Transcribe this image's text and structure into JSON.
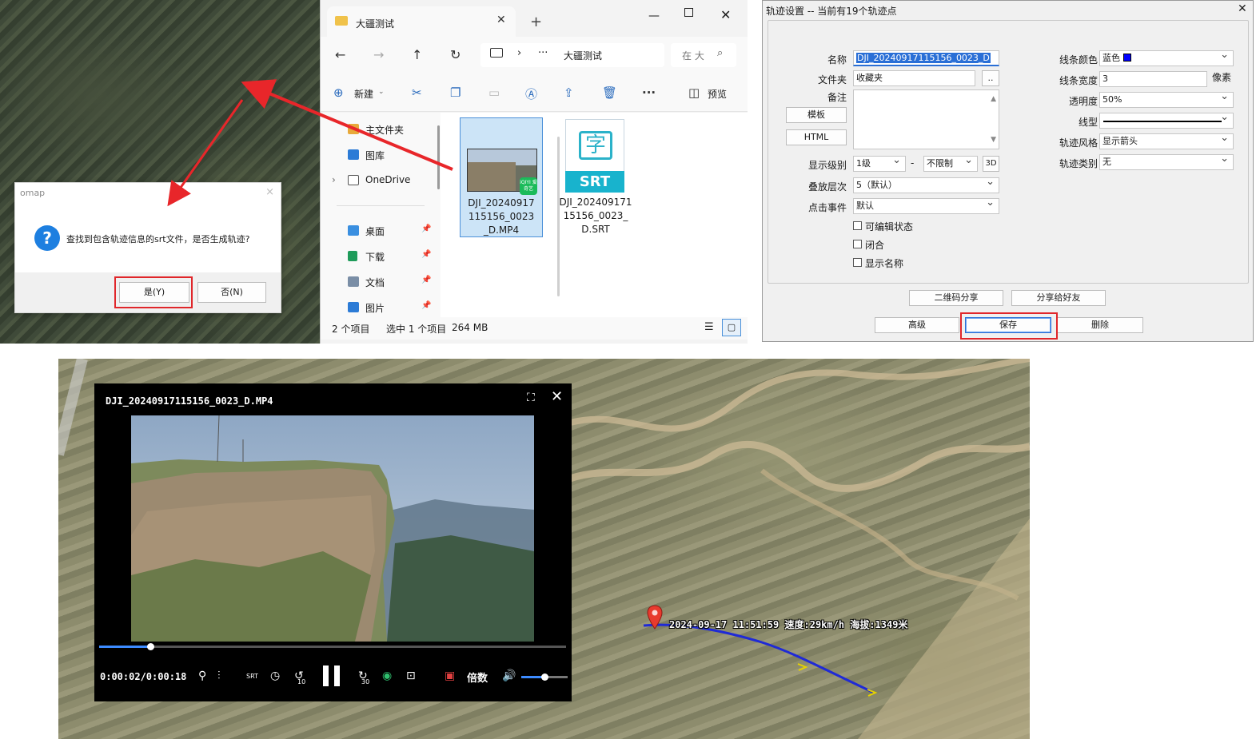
{
  "omap_dialog": {
    "title": "omap",
    "close": "×",
    "question_icon": "?",
    "message": "查找到包含轨迹信息的srt文件，是否生成轨迹?",
    "yes_label": "是(Y)",
    "no_label": "否(N)"
  },
  "explorer": {
    "tab_title": "大疆测试",
    "tab_close": "✕",
    "new_tab": "+",
    "address": {
      "chevron": "›",
      "dots": "···",
      "path": "大疆测试"
    },
    "search_placeholder": "在 大",
    "toolbar": {
      "new_label": "新建",
      "preview_label": "预览"
    },
    "sidebar": [
      {
        "label": "主文件夹",
        "icon": "home-icon",
        "pinned": false
      },
      {
        "label": "图库",
        "icon": "gallery-icon",
        "pinned": false
      },
      {
        "label": "OneDrive",
        "icon": "cloud-icon",
        "pinned": false
      },
      {
        "label": "桌面",
        "icon": "desktop-icon",
        "pinned": true
      },
      {
        "label": "下载",
        "icon": "download-icon",
        "pinned": true
      },
      {
        "label": "文档",
        "icon": "document-icon",
        "pinned": true
      },
      {
        "label": "图片",
        "icon": "pictures-icon",
        "pinned": true
      }
    ],
    "files": [
      {
        "name": "DJI_20240917115156_0023_D.MP4",
        "type": "video",
        "badge": "iQIYI 爱奇艺"
      },
      {
        "name": "DJI_20240917115156_0023_D.SRT",
        "type": "srt",
        "glyph": "字",
        "band": "SRT"
      }
    ],
    "status": {
      "count": "2 个项目",
      "selected": "选中 1 个项目",
      "size": "264 MB"
    }
  },
  "track_dialog": {
    "title": "轨迹设置 -- 当前有19个轨迹点",
    "close": "✕",
    "labels": {
      "name": "名称",
      "folder": "文件夹",
      "note": "备注",
      "display_level": "显示级别",
      "stack_level": "叠放层次",
      "click_event": "点击事件",
      "line_color": "线条颜色",
      "line_width": "线条宽度",
      "opacity": "透明度",
      "line_type": "线型",
      "track_style": "轨迹风格",
      "track_type": "轨迹类别",
      "pixels": "像素",
      "dash": "-"
    },
    "values": {
      "name": "DJI_20240917115156_0023_D",
      "folder": "收藏夹",
      "folder_browse": "..",
      "display_level_from": "1级",
      "display_level_to": "不限制",
      "btn_3d": "3D",
      "stack_level": "5（默认）",
      "click_event": "默认",
      "line_color": "蓝色",
      "line_color_hex": "#0000ff",
      "line_width": "3",
      "opacity": "50%",
      "track_style": "显示箭头",
      "track_type": "无"
    },
    "buttons": {
      "template": "模板",
      "html": "HTML",
      "qr_share": "二维码分享",
      "share_friend": "分享给好友",
      "advanced": "高级",
      "save": "保存",
      "delete": "删除"
    },
    "checks": [
      {
        "label": "可编辑状态",
        "checked": false
      },
      {
        "label": "闭合",
        "checked": false
      },
      {
        "label": "显示名称",
        "checked": false
      }
    ]
  },
  "video_player": {
    "title": "DJI_20240917115156_0023_D.MP4",
    "time": "0:00:02/0:00:18",
    "progress_fraction": 0.11,
    "volume_fraction": 0.5,
    "speed_label": "倍数",
    "skip_back": "10",
    "skip_forward": "30",
    "srt": "SRT"
  },
  "track_annotation": "2024-09-17 11:51:59 速度:29km/h 海拔:1349米",
  "colors": {
    "highlight_red": "#e0262a",
    "track_blue": "#1f2ad6",
    "progress_blue": "#3d8bff"
  }
}
